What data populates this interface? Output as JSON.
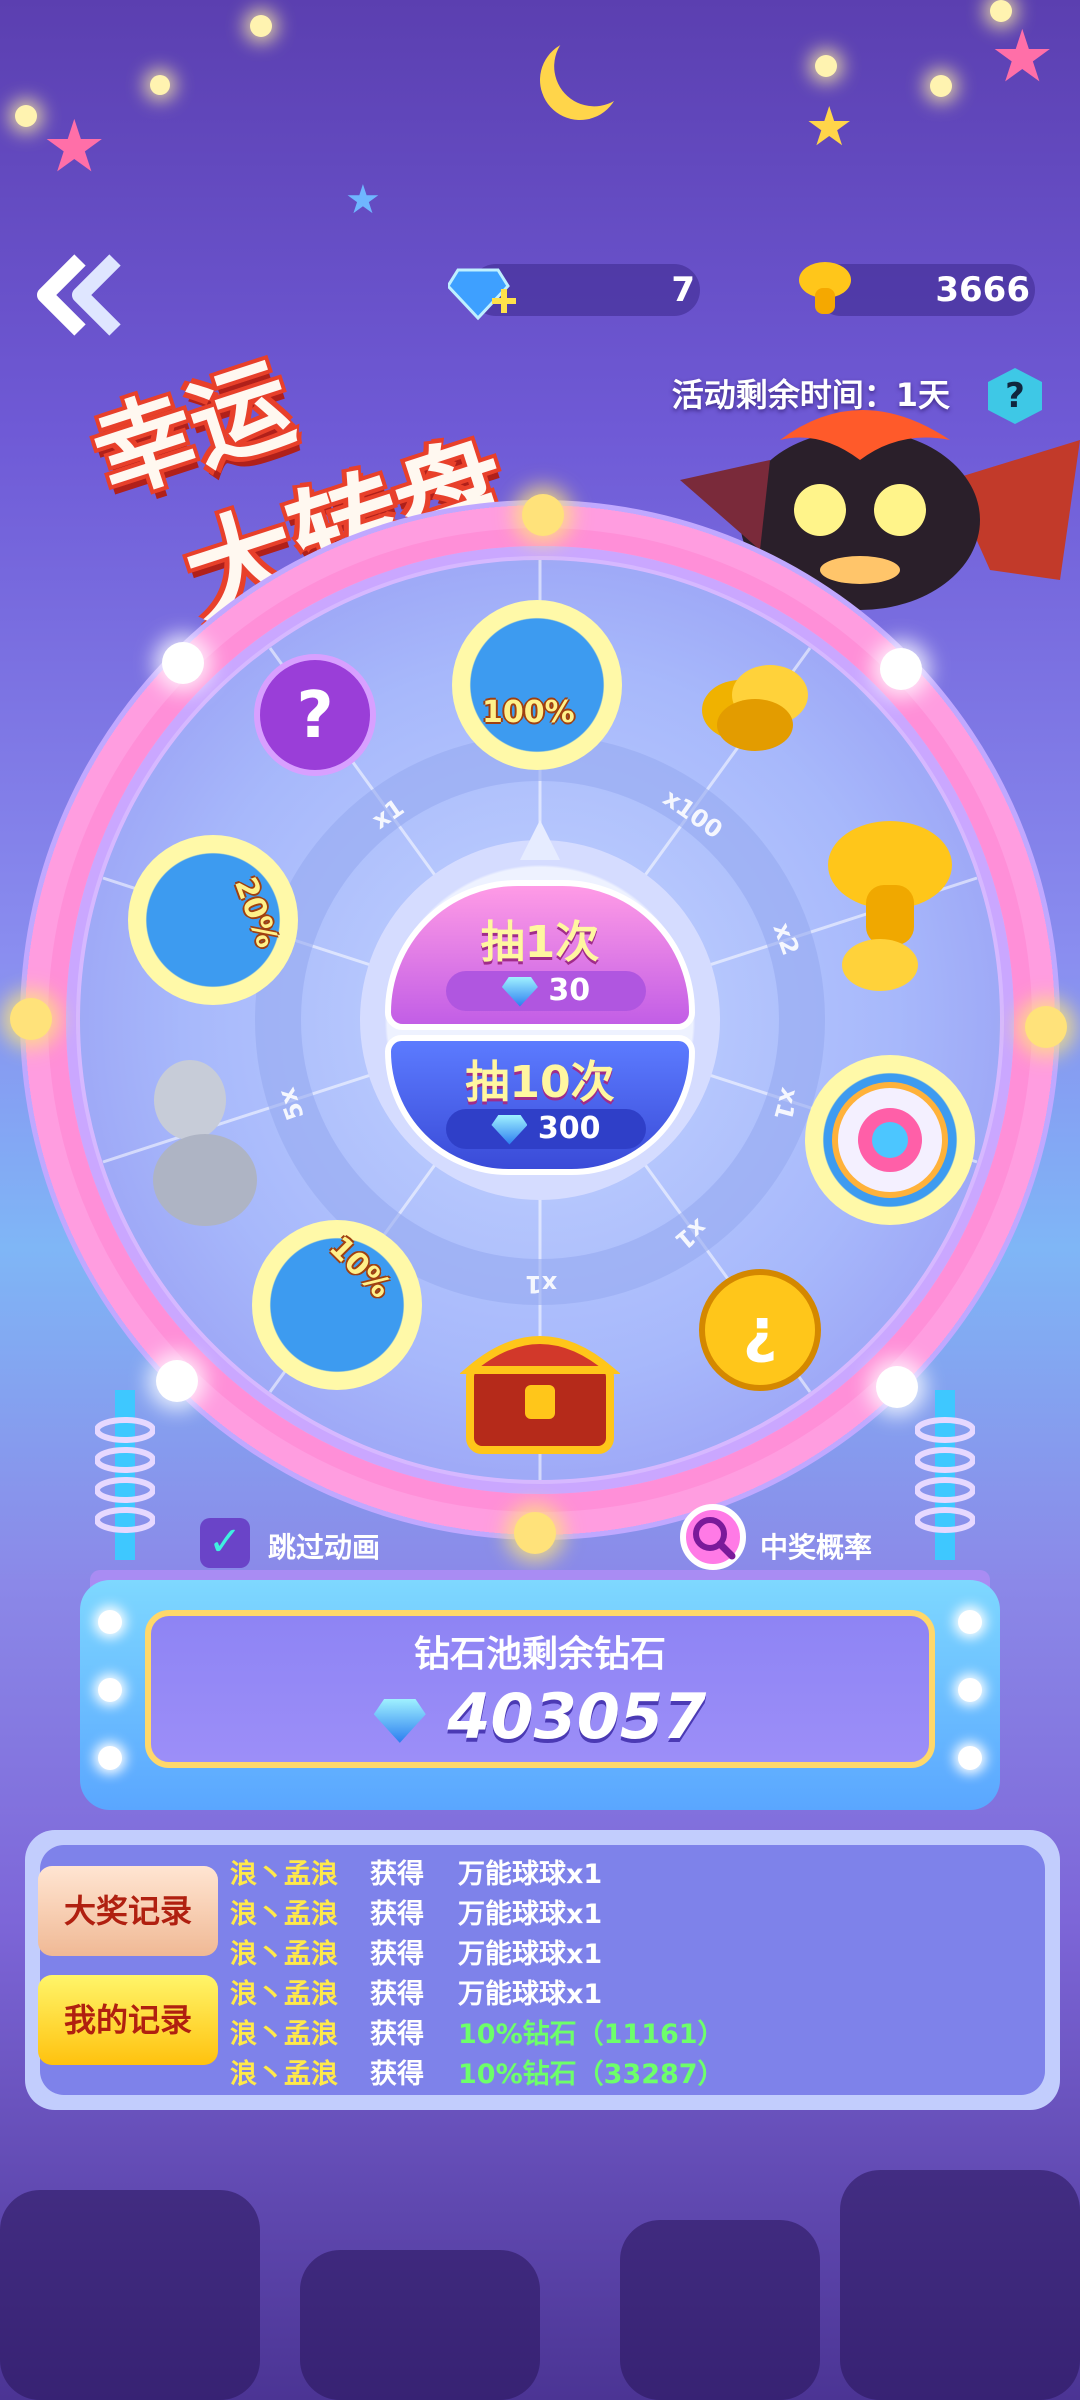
{
  "header": {
    "gems": "7",
    "gold": "3666",
    "timer_label": "活动剩余时间：1天",
    "help_label": "?"
  },
  "title": {
    "line1": "幸运",
    "line2": "大转盘"
  },
  "wheel": {
    "prizes": [
      {
        "name": "gem-100",
        "label": "100%"
      },
      {
        "name": "gold-coins",
        "label": ""
      },
      {
        "name": "gold-mushroom",
        "label": ""
      },
      {
        "name": "rainbow-egg",
        "label": ""
      },
      {
        "name": "gold-sphere",
        "label": ""
      },
      {
        "name": "treasure-chest",
        "label": ""
      },
      {
        "name": "gem-10",
        "label": "10%"
      },
      {
        "name": "stone-statue",
        "label": ""
      },
      {
        "name": "gem-20",
        "label": "20%"
      },
      {
        "name": "mystery-ball",
        "label": ""
      }
    ],
    "multipliers": [
      "x100",
      "x2",
      "x1",
      "x1",
      "x1",
      "5x",
      "x1"
    ]
  },
  "spin_once": {
    "label": "抽1次",
    "cost": "30"
  },
  "spin_ten": {
    "label": "抽10次",
    "cost": "300"
  },
  "controls": {
    "skip_label": "跳过动画",
    "odds_label": "中奖概率"
  },
  "pool": {
    "title": "钻石池剩余钻石",
    "value": "403057"
  },
  "records": {
    "tab_grand": "大奖记录",
    "tab_mine": "我的记录",
    "rows": [
      {
        "user": "浪丶孟浪",
        "verb": "获得",
        "item": "万能球球x1",
        "highlight": false
      },
      {
        "user": "浪丶孟浪",
        "verb": "获得",
        "item": "万能球球x1",
        "highlight": false
      },
      {
        "user": "浪丶孟浪",
        "verb": "获得",
        "item": "万能球球x1",
        "highlight": false
      },
      {
        "user": "浪丶孟浪",
        "verb": "获得",
        "item": "万能球球x1",
        "highlight": false
      },
      {
        "user": "浪丶孟浪",
        "verb": "获得",
        "item": "10%钻石（11161）",
        "highlight": true
      },
      {
        "user": "浪丶孟浪",
        "verb": "获得",
        "item": "10%钻石（33287）",
        "highlight": true
      }
    ]
  }
}
